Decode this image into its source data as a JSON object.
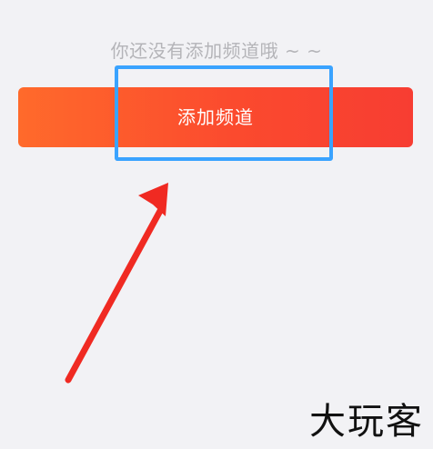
{
  "empty_state": {
    "message": "你还没有添加频道哦 ~ ~"
  },
  "add_channel_button": {
    "label": "添加频道"
  },
  "annotation": {
    "highlight_color": "#3aa3ff",
    "arrow_color": "#f02a22"
  },
  "watermark": {
    "text": "大玩客"
  },
  "colors": {
    "background": "#f2f2f5",
    "button_gradient_start": "#ff6a2b",
    "button_gradient_end": "#f73d32"
  }
}
